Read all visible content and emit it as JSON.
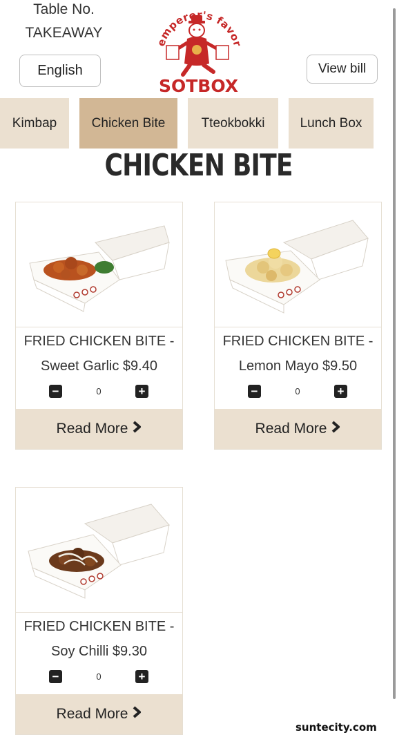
{
  "header": {
    "table_label": "Table No.",
    "table_value": "TAKEAWAY",
    "language_button": "English",
    "view_bill_button": "View bill"
  },
  "logo": {
    "arc_text": "emperor's favorite",
    "brand": "SOTBOX",
    "bag_text": "SOTBOX",
    "brand_color": "#c62828"
  },
  "categories": [
    {
      "label": "Kimbap",
      "active": false
    },
    {
      "label": "Chicken Bite",
      "active": true
    },
    {
      "label": "Tteokbokki",
      "active": false
    },
    {
      "label": "Lunch Box",
      "active": false
    }
  ],
  "section": {
    "title": "CHICKEN BITE"
  },
  "products": [
    {
      "line1": "FRIED CHICKEN BITE -",
      "line2": "Sweet Garlic $9.40",
      "quantity": "0",
      "read_more": "Read More"
    },
    {
      "line1": "FRIED CHICKEN BITE -",
      "line2": "Lemon Mayo $9.50",
      "quantity": "0",
      "read_more": "Read More"
    },
    {
      "line1": "FRIED CHICKEN BITE -",
      "line2": "Soy Chilli $9.30",
      "quantity": "0",
      "read_more": "Read More"
    }
  ],
  "colors": {
    "tab_bg": "#ebe0d0",
    "tab_active_bg": "#d2b795",
    "read_more_bg": "#ebe0d0"
  },
  "icons": {
    "minus": "minus-square-icon",
    "plus": "plus-square-icon",
    "chevron": "chevron-right-icon"
  },
  "watermark": "suntecity.com"
}
